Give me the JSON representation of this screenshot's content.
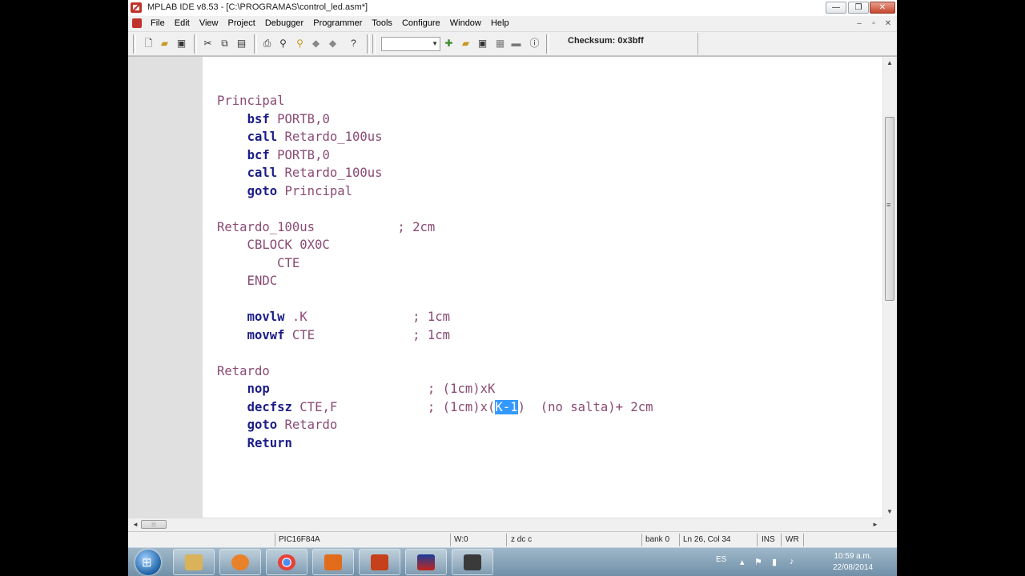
{
  "window": {
    "title": "MPLAB IDE v8.53 - [C:\\PROGRAMAS\\control_led.asm*]",
    "min_label": "—",
    "max_label": "❐",
    "close_label": "✕"
  },
  "menu": {
    "items": [
      "File",
      "Edit",
      "View",
      "Project",
      "Debugger",
      "Programmer",
      "Tools",
      "Configure",
      "Window",
      "Help"
    ],
    "mdi_min": "–",
    "mdi_restore": "▫",
    "mdi_close": "✕"
  },
  "toolbar": {
    "config_value": "",
    "checksum": "Checksum:  0x3bff",
    "icons": [
      "new-file-icon",
      "open-folder-icon",
      "save-icon",
      "cut-icon",
      "copy-icon",
      "paste-icon",
      "print-icon",
      "find-icon",
      "find-in-files-icon",
      "bookmark-icon",
      "bookmark-next-icon",
      "help-icon",
      "new-project-icon",
      "open-project-icon",
      "save-project-icon",
      "build-icon",
      "make-icon",
      "info-icon"
    ]
  },
  "editor": {
    "highlight_color": "#3399ff",
    "keyword_color": "#1c1d88",
    "text_color": "#8a4a74"
  },
  "status": {
    "device": "PIC16F84A",
    "w_reg": "W:0",
    "flags": "z dc c",
    "bank": "bank 0",
    "position": "Ln 26, Col 34",
    "ins": "INS",
    "wr": "WR"
  },
  "taskbar": {
    "lang": "ES",
    "time": "10:59 a.m.",
    "date": "22/08/2014",
    "apps": [
      "file-explorer",
      "media-player",
      "chrome",
      "presenter",
      "powerpoint",
      "mplab",
      "camera-app"
    ]
  }
}
